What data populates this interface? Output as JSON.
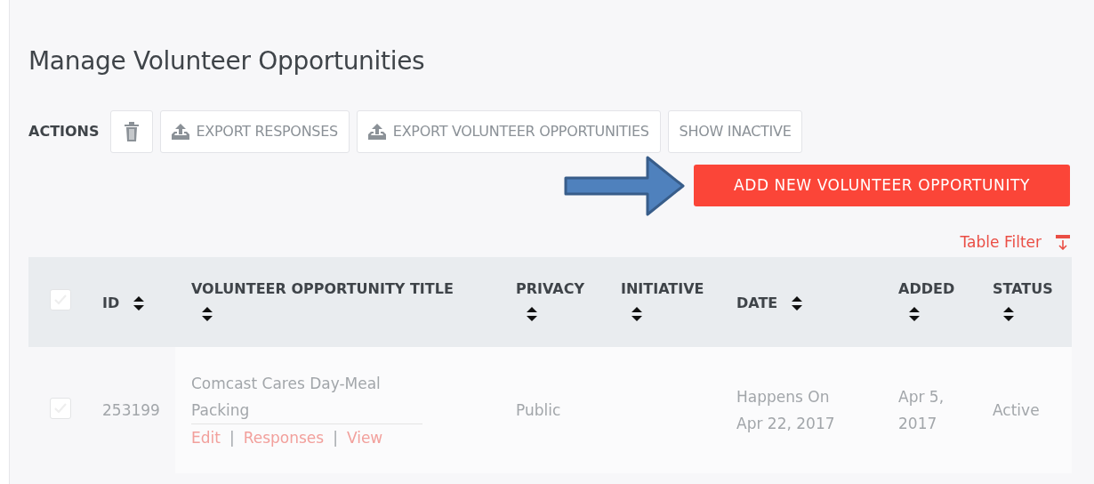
{
  "page": {
    "title": "Manage Volunteer Opportunities"
  },
  "actions": {
    "label": "ACTIONS",
    "buttons": [
      {
        "kind": "delete"
      },
      {
        "kind": "export",
        "label": "EXPORT RESPONSES"
      },
      {
        "kind": "export",
        "label": "EXPORT VOLUNTEER OPPORTUNITIES"
      },
      {
        "kind": "plain",
        "label": "SHOW INACTIVE"
      }
    ]
  },
  "add_button": {
    "label": "ADD NEW VOLUNTEER OPPORTUNITY"
  },
  "table_filter": {
    "label": "Table Filter"
  },
  "table": {
    "select_all": {
      "checked": false,
      "disabled": true
    },
    "columns": [
      {
        "label": "ID",
        "kind": "inline"
      },
      {
        "label": "VOLUNTEER OPPORTUNITY TITLE",
        "kind": "stacked"
      },
      {
        "label": "PRIVACY",
        "kind": "stacked"
      },
      {
        "label": "INITIATIVE",
        "kind": "stacked"
      },
      {
        "label": "DATE",
        "kind": "inline"
      },
      {
        "label": "ADDED",
        "kind": "stacked"
      },
      {
        "label": "STATUS",
        "kind": "stacked"
      }
    ],
    "rows": [
      {
        "checked": false,
        "disabled": true,
        "id": "253199",
        "title": "Comcast Cares Day-Meal Packing",
        "links": [
          "Edit",
          "Responses",
          "View"
        ],
        "link_separator": "|",
        "privacy": "Public",
        "date": "Happens On Apr 22, 2017",
        "added": "Apr 5, 2017",
        "status": "Active"
      }
    ]
  }
}
